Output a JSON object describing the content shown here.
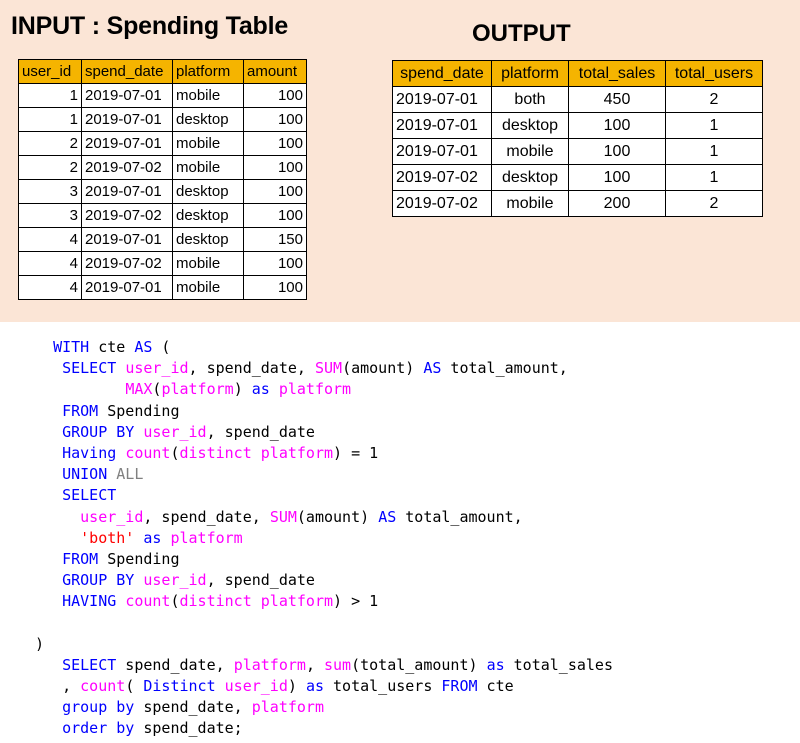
{
  "input_title": "INPUT : Spending Table",
  "output_title": "OUTPUT",
  "input_table": {
    "headers": [
      "user_id",
      "spend_date",
      "platform",
      "amount"
    ],
    "rows": [
      [
        "1",
        "2019-07-01",
        "mobile",
        "100"
      ],
      [
        "1",
        "2019-07-01",
        "desktop",
        "100"
      ],
      [
        "2",
        "2019-07-01",
        "mobile",
        "100"
      ],
      [
        "2",
        "2019-07-02",
        "mobile",
        "100"
      ],
      [
        "3",
        "2019-07-01",
        "desktop",
        "100"
      ],
      [
        "3",
        "2019-07-02",
        "desktop",
        "100"
      ],
      [
        "4",
        "2019-07-01",
        "desktop",
        "150"
      ],
      [
        "4",
        "2019-07-02",
        "mobile",
        "100"
      ],
      [
        "4",
        "2019-07-01",
        "mobile",
        "100"
      ]
    ]
  },
  "output_table": {
    "headers": [
      "spend_date",
      "platform",
      "total_sales",
      "total_users"
    ],
    "rows": [
      [
        "2019-07-01",
        "both",
        "450",
        "2"
      ],
      [
        "2019-07-01",
        "desktop",
        "100",
        "1"
      ],
      [
        "2019-07-01",
        "mobile",
        "100",
        "1"
      ],
      [
        "2019-07-02",
        "desktop",
        "100",
        "1"
      ],
      [
        "2019-07-02",
        "mobile",
        "200",
        "2"
      ]
    ]
  },
  "sql": {
    "l01": [
      "WITH",
      " cte ",
      "AS",
      " ("
    ],
    "l02": [
      "SELECT",
      "user_id",
      ", spend_date, ",
      "SUM",
      "(amount) ",
      "AS",
      " total_amount,"
    ],
    "l03": [
      "MAX",
      "(",
      "platform",
      ") ",
      "as",
      " ",
      "platform"
    ],
    "l04": [
      "FROM",
      " Spending"
    ],
    "l05": [
      "GROUP BY",
      " ",
      "user_id",
      ", spend_date"
    ],
    "l06": [
      "Having",
      " ",
      "count",
      "(",
      "distinct",
      " ",
      "platform",
      ") = 1"
    ],
    "l07": [
      "UNION",
      " ",
      "ALL"
    ],
    "l08": [
      "SELECT"
    ],
    "l09": [
      "user_id",
      ", spend_date, ",
      "SUM",
      "(amount) ",
      "AS",
      " total_amount,"
    ],
    "l10": [
      "'both'",
      " ",
      "as",
      " ",
      "platform"
    ],
    "l11": [
      "FROM",
      " Spending"
    ],
    "l12": [
      "GROUP BY",
      " ",
      "user_id",
      ", spend_date"
    ],
    "l13": [
      "HAVING",
      " ",
      "count",
      "(",
      "distinct",
      " ",
      "platform",
      ") > 1"
    ],
    "l14": [
      ")"
    ],
    "l15": [
      "SELECT",
      " spend_date, ",
      "platform",
      ", ",
      "sum",
      "(total_amount) ",
      "as",
      " total_sales"
    ],
    "l16": [
      ", ",
      "count",
      "( ",
      "Distinct",
      " ",
      "user_id",
      ") ",
      "as",
      " total_users ",
      "FROM",
      " cte"
    ],
    "l17": [
      "group by",
      " spend_date, ",
      "platform"
    ],
    "l18": [
      "order by",
      " spend_date;"
    ]
  }
}
